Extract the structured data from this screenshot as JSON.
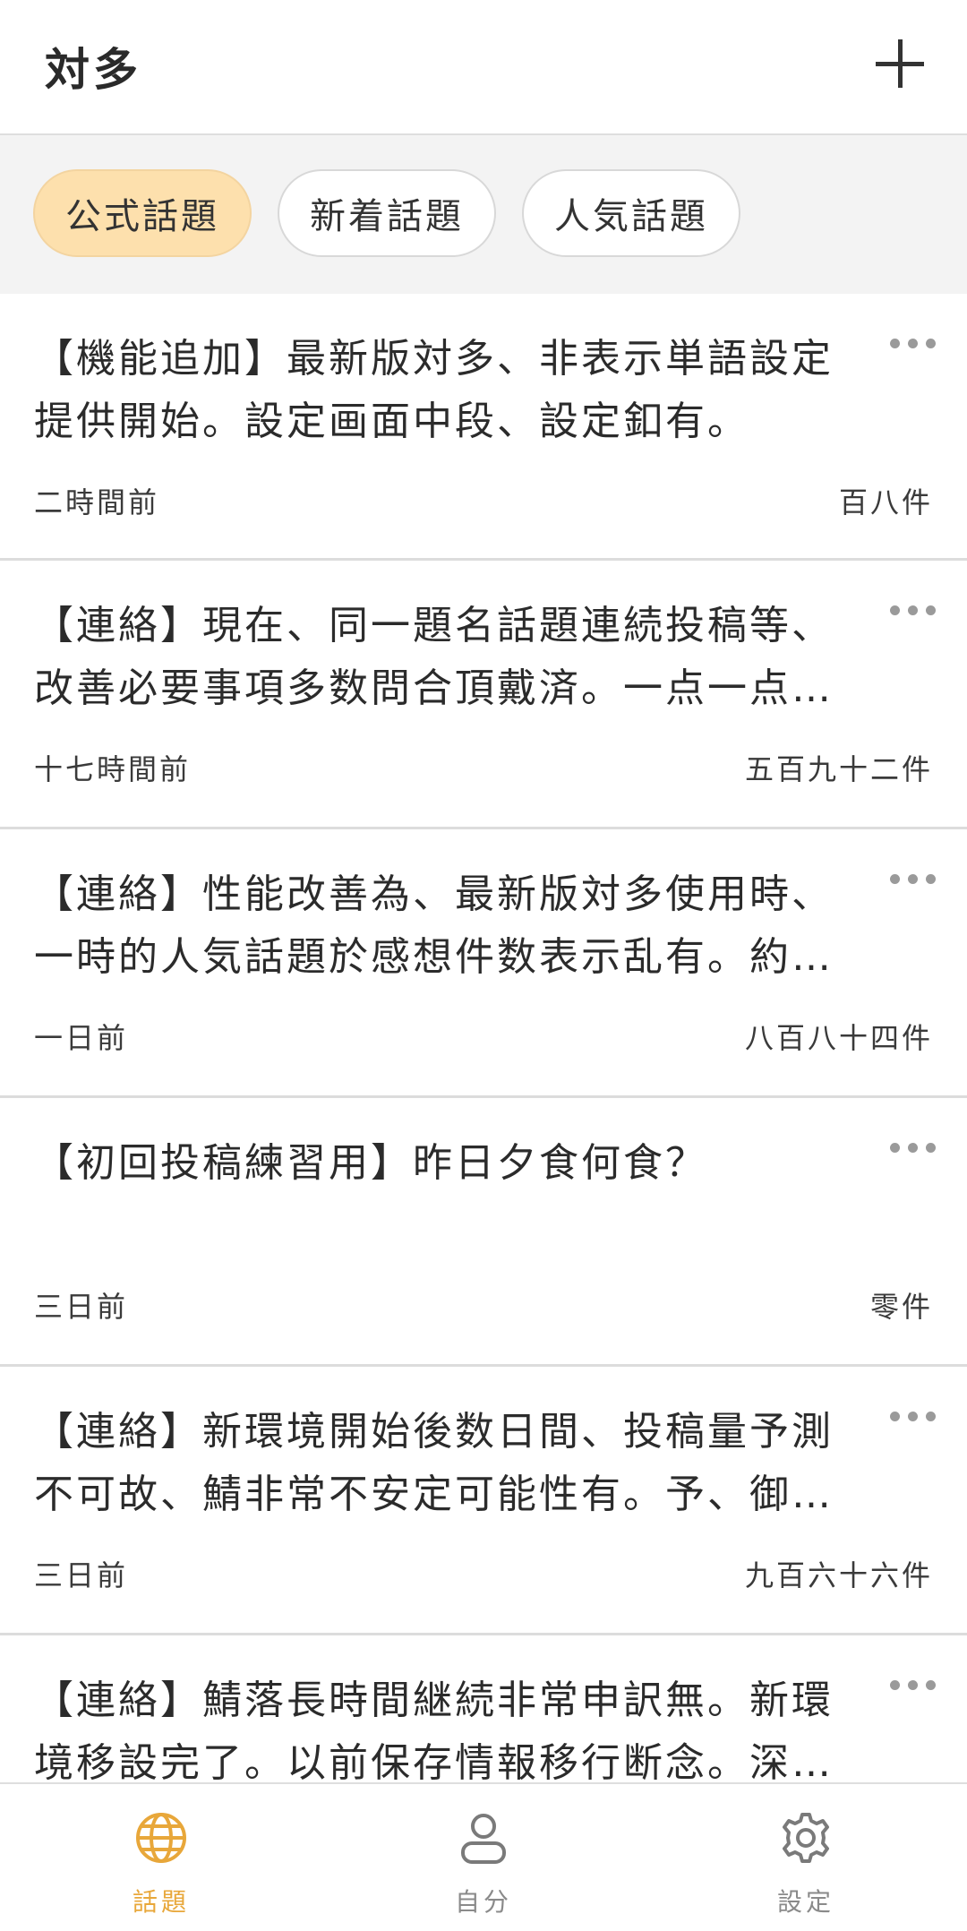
{
  "header": {
    "title": "対多"
  },
  "tabs": [
    {
      "label": "公式話題",
      "active": true
    },
    {
      "label": "新着話題",
      "active": false
    },
    {
      "label": "人気話題",
      "active": false
    }
  ],
  "posts": [
    {
      "text": "【機能追加】最新版対多、非表示単語設定提供開始。設定画面中段、設定釦有。",
      "time": "二時間前",
      "count": "百八件"
    },
    {
      "text": "【連絡】現在、同一題名話題連続投稿等、改善必要事項多数問合頂戴済。一点一点…",
      "time": "十七時間前",
      "count": "五百九十二件"
    },
    {
      "text": "【連絡】性能改善為、最新版対多使用時、一時的人気話題於感想件数表示乱有。約…",
      "time": "一日前",
      "count": "八百八十四件"
    },
    {
      "text": "【初回投稿練習用】昨日夕食何食？",
      "time": "三日前",
      "count": "零件"
    },
    {
      "text": "【連絡】新環境開始後数日間、投稿量予測不可故、鯖非常不安定可能性有。予、御…",
      "time": "三日前",
      "count": "九百六十六件"
    },
    {
      "text": "【連絡】鯖落長時間継続非常申訳無。新環境移設完了。以前保存情報移行断念。深…",
      "time": "",
      "count": ""
    }
  ],
  "nav": [
    {
      "label": "話題",
      "icon": "globe-icon",
      "active": true
    },
    {
      "label": "自分",
      "icon": "person-icon",
      "active": false
    },
    {
      "label": "設定",
      "icon": "gear-icon",
      "active": false
    }
  ],
  "colors": {
    "accent": "#e8a73a",
    "chip_active_bg": "#fde0ad",
    "nav_inactive": "#8a8a8a"
  }
}
